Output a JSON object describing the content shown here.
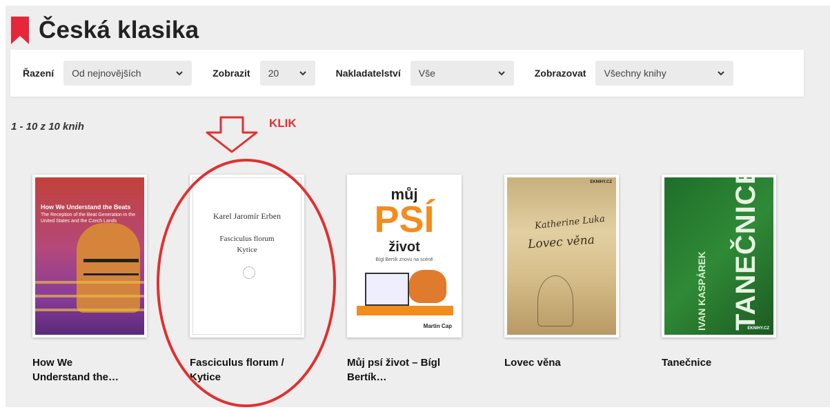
{
  "header": {
    "title": "Česká klasika",
    "bookmark_icon": "bookmark-icon",
    "accent": "#e6263a"
  },
  "filters": [
    {
      "label": "Řazení",
      "value": "Od nejnovějších"
    },
    {
      "label": "Zobrazit",
      "value": "20"
    },
    {
      "label": "Nakladatelství",
      "value": "Vše"
    },
    {
      "label": "Zobrazovat",
      "value": "Všechny knihy"
    }
  ],
  "results": {
    "count_text": "1 - 10 z 10 knih"
  },
  "annotation": {
    "klik": "KLIK",
    "color": "#e03030"
  },
  "books": [
    {
      "title_line1": "How We",
      "title_line2": "Understand the…",
      "cover": {
        "title": "How We Understand the Beats",
        "subtitle": "The Reception of the Beat Generation in the United States and the Czech Lands"
      }
    },
    {
      "title_line1": "Fasciculus florum /",
      "title_line2": "Kytice",
      "cover": {
        "author": "Karel Jaromír Erben",
        "title_1": "Fasciculus florum",
        "title_2": "Kytice"
      }
    },
    {
      "title_line1": "Můj psí život – Bígl",
      "title_line2": "Bertík…",
      "cover": {
        "line1": "můj",
        "line2": "PSÍ",
        "line3": "život",
        "tagline": "Bígl Bertík znovu na scéně",
        "author": "Martin Cap"
      }
    },
    {
      "title_line1": "Lovec věna",
      "title_line2": "",
      "cover": {
        "script_1": "Katherine Luka",
        "script_2": "Lovec věna",
        "publisher": "EKNIHY.CZ"
      }
    },
    {
      "title_line1": "Tanečnice",
      "title_line2": "",
      "cover": {
        "author": "IVAN KASPÁREK",
        "title": "TANEČNICE",
        "publisher": "EKNIHY.CZ"
      }
    }
  ]
}
